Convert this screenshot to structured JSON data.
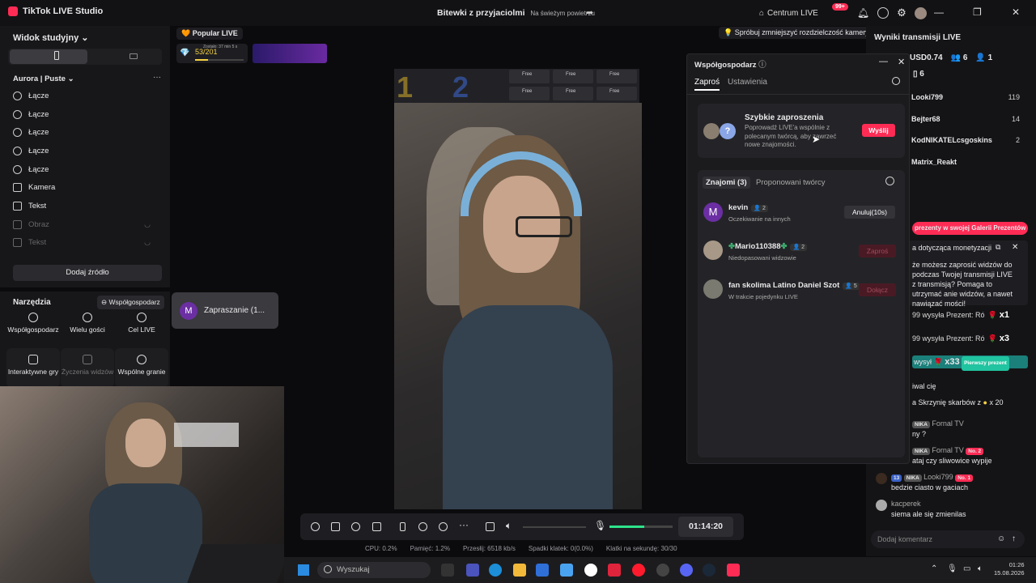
{
  "app": {
    "title": "TikTok LIVE Studio",
    "stream_title": "Bitewki z przyjaciolmi",
    "stream_subtitle": "Na świeżym powietrzu",
    "live_center": "Centrum LIVE",
    "notif_badge": "99+"
  },
  "left": {
    "view_title": "Widok studyjny",
    "scene_title": "Aurora | Puste",
    "sources": [
      {
        "label": "Łącze",
        "icon": "globe-icon"
      },
      {
        "label": "Łącze",
        "icon": "globe-icon"
      },
      {
        "label": "Łącze",
        "icon": "globe-icon"
      },
      {
        "label": "Łącze",
        "icon": "globe-icon"
      },
      {
        "label": "Łącze",
        "icon": "globe-icon"
      },
      {
        "label": "Kamera",
        "icon": "camera-icon"
      },
      {
        "label": "Tekst",
        "icon": "text-icon"
      },
      {
        "label": "Obraz",
        "icon": "image-icon"
      },
      {
        "label": "Tekst",
        "icon": "text-icon"
      }
    ],
    "add_source": "Dodaj źródło",
    "tools_title": "Narzędzia",
    "cohost_chip": "Współgospodarz",
    "tools": [
      {
        "label": "Współgospodarz"
      },
      {
        "label": "Wielu gości"
      },
      {
        "label": "Cel LIVE"
      },
      {
        "label": "Interaktywne gry"
      },
      {
        "label": "Życzenia widzów"
      },
      {
        "label": "Wspólne granie"
      }
    ],
    "tooltip_avatar": "M",
    "tooltip_text": "Zapraszanie (1..."
  },
  "center": {
    "popular": "Popular LIVE",
    "game_progress": "53/201",
    "game_timer": "Zostało: 37 min 5 s",
    "game_progress_value": 0.26,
    "res_notice": "Spróbuj zmniejszyć rozdzielczość kamery",
    "score_left": "1",
    "score_right": "2",
    "slot_label": "Free",
    "timer": "01:14:20",
    "volume_level": 0.55,
    "status": {
      "cpu": "CPU:  0.2%",
      "mem": "Pamięć:  1.2%",
      "bitrate": "Przesłij:  6518 kb/s",
      "dropped": "Spadki klatek:  0(0.0%)",
      "fps": "Klatki na sekundę:  30/30"
    }
  },
  "modal": {
    "title": "Współgospodarz",
    "tab_invite": "Zaproś",
    "tab_settings": "Ustawienia",
    "quick_title": "Szybkie zaproszenia",
    "quick_desc": "Poprowadź LIVE'a wspólnie z polecanym twórcą, aby zawrzeć nowe znajomości.",
    "send": "Wyślij",
    "friends_tab": "Znajomi (3)",
    "suggested_tab": "Proponowani twórcy",
    "friends": [
      {
        "name": "kevin",
        "count": "2",
        "status": "Oczekiwanie na innych",
        "action": "Anuluj(10s)",
        "avatar": "M"
      },
      {
        "name": "Mario110388",
        "count": "2",
        "status": "Niedopasowani widzowie",
        "action": "Zaproś"
      },
      {
        "name": "fan skolima Latino Daniel Szot",
        "count": "5",
        "status": "W trakcie pojedynku LIVE",
        "action": "Dołącz"
      }
    ]
  },
  "right": {
    "title": "Wyniki transmisji LIVE",
    "usd": "USD0.74",
    "viewers": "6",
    "likes": "1",
    "gifts": "6",
    "ranking": [
      {
        "name": "Looki799",
        "value": "119"
      },
      {
        "name": "Bejter68",
        "value": "14"
      },
      {
        "name": "KodNIKATELcsgoskins",
        "value": "2"
      },
      {
        "name": "Matrix_Reakt",
        "value": ""
      }
    ],
    "gallery": "prezenty w swojej Galerii Prezentów",
    "monet_title": "a dotycząca monetyzacji",
    "monet_desc": "że możesz zaprosić widzów do podczas Twojej transmisji LIVE z transmisją? Pomaga to utrzymać anie widzów, a nawet nawiązać mości!",
    "gift1": "99 wysyła Prezent: Ró",
    "gift1_count": "x1",
    "gift2": "99 wysyła Prezent: Ró",
    "gift2_count": "x3",
    "gift3": "wysył",
    "gift3_count": "x33",
    "first_gift": "Pierwszy prezent",
    "chat": [
      "iwal cię",
      "a Skrzynię skarbów z",
      "x 20",
      "NIKA",
      "Fornal TV",
      "ny ?",
      "No. 2",
      "ataj czy sliwowice wypije",
      "13",
      "Looki799",
      "No. 1",
      "bedzie ciasto w gaciach",
      "kacperek",
      "siema ale się zmienilas"
    ],
    "comment_placeholder": "Dodaj komentarz"
  },
  "taskbar": {
    "search": "Wyszukaj",
    "time": "01:26",
    "date": "15.08.2026"
  },
  "colors": {
    "accent": "#fe2c55",
    "gold": "#f5d142",
    "teal": "#1b7f7a",
    "volume": "#2de38a"
  }
}
